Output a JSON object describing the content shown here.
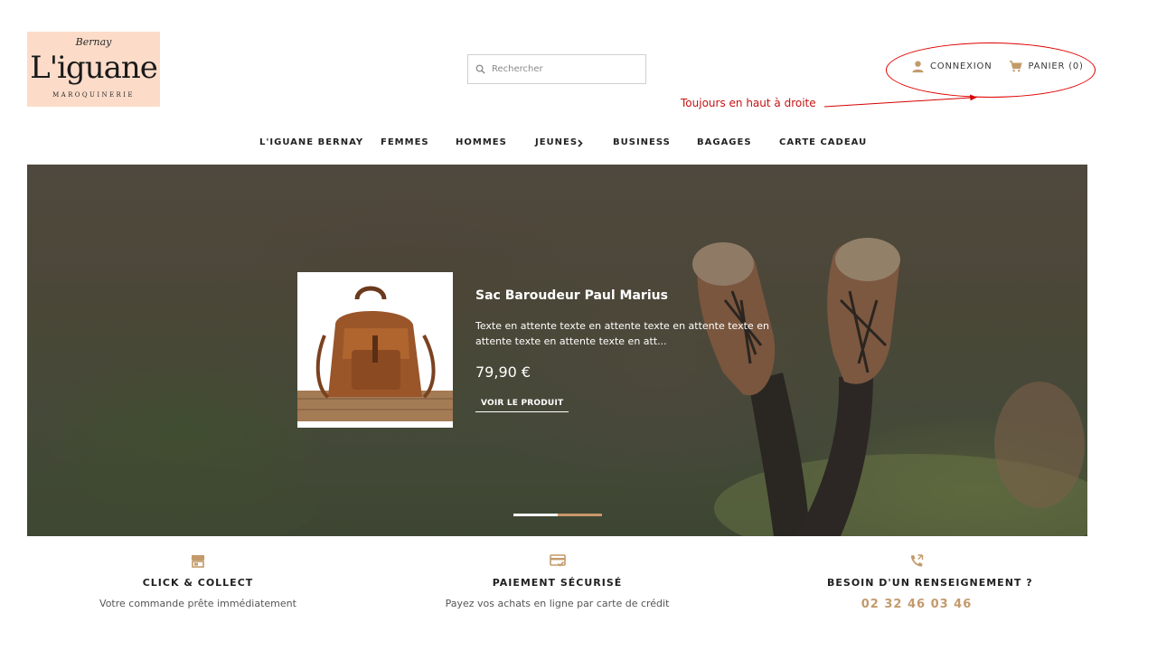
{
  "logo": {
    "script": "Bernay",
    "brand": "L'iguane",
    "sub": "MAROQUINERIE"
  },
  "search": {
    "placeholder": "Rechercher"
  },
  "header": {
    "login_label": "CONNEXION",
    "cart_label": "PANIER (0)"
  },
  "annotation": {
    "note": "Toujours en haut à droite",
    "color": "#d40000"
  },
  "nav": {
    "items": [
      {
        "label": "L'IGUANE BERNAY"
      },
      {
        "label": "FEMMES"
      },
      {
        "label": "HOMMES"
      },
      {
        "label": "JEUNES"
      },
      {
        "label": "BUSINESS"
      },
      {
        "label": "BAGAGES"
      },
      {
        "label": "CARTE CADEAU"
      }
    ]
  },
  "hero": {
    "title": "Sac Baroudeur Paul Marius",
    "description": "Texte en attente texte en attente texte en attente texte en attente texte en attente texte en att...",
    "price": "79,90 €",
    "cta": "VOIR LE PRODUIT",
    "slides_total": 2,
    "active_slide": 1
  },
  "features": [
    {
      "title": "CLICK & COLLECT",
      "subtitle": "Votre commande prête immédiatement",
      "icon": "store-icon"
    },
    {
      "title": "PAIEMENT SÉCURISÉ",
      "subtitle": "Payez vos achats en ligne par carte de crédit",
      "icon": "credit-card-icon"
    },
    {
      "title": "BESOIN D'UN RENSEIGNEMENT ?",
      "subtitle": "02 32 46 03 46",
      "icon": "phone-icon"
    }
  ],
  "colors": {
    "accent": "#c39a6b",
    "logo_bg": "#fcdcc9",
    "text": "#232323"
  }
}
